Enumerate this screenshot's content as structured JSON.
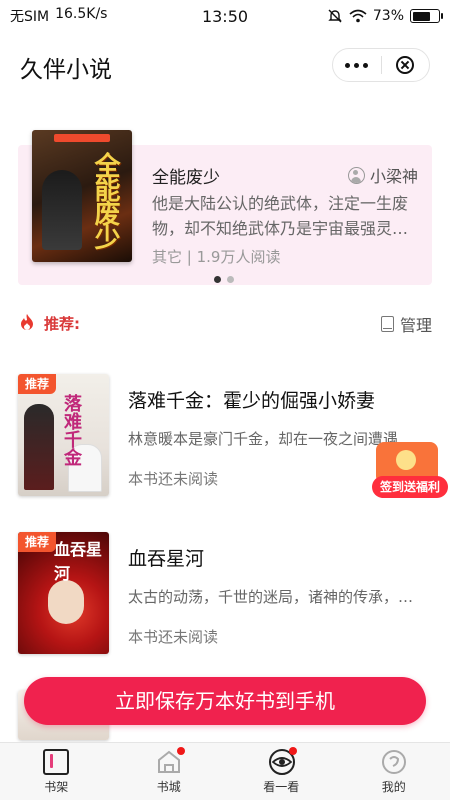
{
  "status_bar": {
    "carrier": "无SIM",
    "speed": "16.5K/s",
    "time": "13:50",
    "battery": "73%",
    "battery_level": 0.73
  },
  "header": {
    "title": "久伴小说"
  },
  "banner": {
    "title": "全能废少",
    "author": "小梁神",
    "description": "他是大陆公认的绝武体，注定一生废物，却不知绝武体乃是宇宙最强灵…",
    "meta": "其它 | 1.9万人阅读",
    "cover_text": "全能废少",
    "pages": 2,
    "active_page": 1
  },
  "section": {
    "title": "推荐:",
    "manage_label": "管理"
  },
  "books": [
    {
      "title": "落难千金：霍少的倔强小娇妻",
      "description": "林意暖本是豪门千金，却在一夜之间遭遇…",
      "status": "本书还未阅读",
      "tag": "推荐",
      "cover_text": "落难千金"
    },
    {
      "title": "血吞星河",
      "description": "太古的动荡，千世的迷局，诸神的传承，…",
      "status": "本书还未阅读",
      "tag": "推荐",
      "cover_text": "血吞星河"
    }
  ],
  "reward": {
    "label": "签到送福利"
  },
  "cta": {
    "label": "立即保存万本好书到手机"
  },
  "tabbar": {
    "tabs": [
      {
        "label": "书架",
        "icon": "bookshelf-icon",
        "badge": false
      },
      {
        "label": "书城",
        "icon": "bookstore-icon",
        "badge": true
      },
      {
        "label": "看一看",
        "icon": "eye-icon",
        "badge": true
      },
      {
        "label": "我的",
        "icon": "profile-icon",
        "badge": false
      }
    ]
  },
  "colors": {
    "accent": "#f0224e",
    "banner_bg": "#fcedf5",
    "recommend_red": "#d93a3a",
    "tag_orange": "#f3552e"
  }
}
